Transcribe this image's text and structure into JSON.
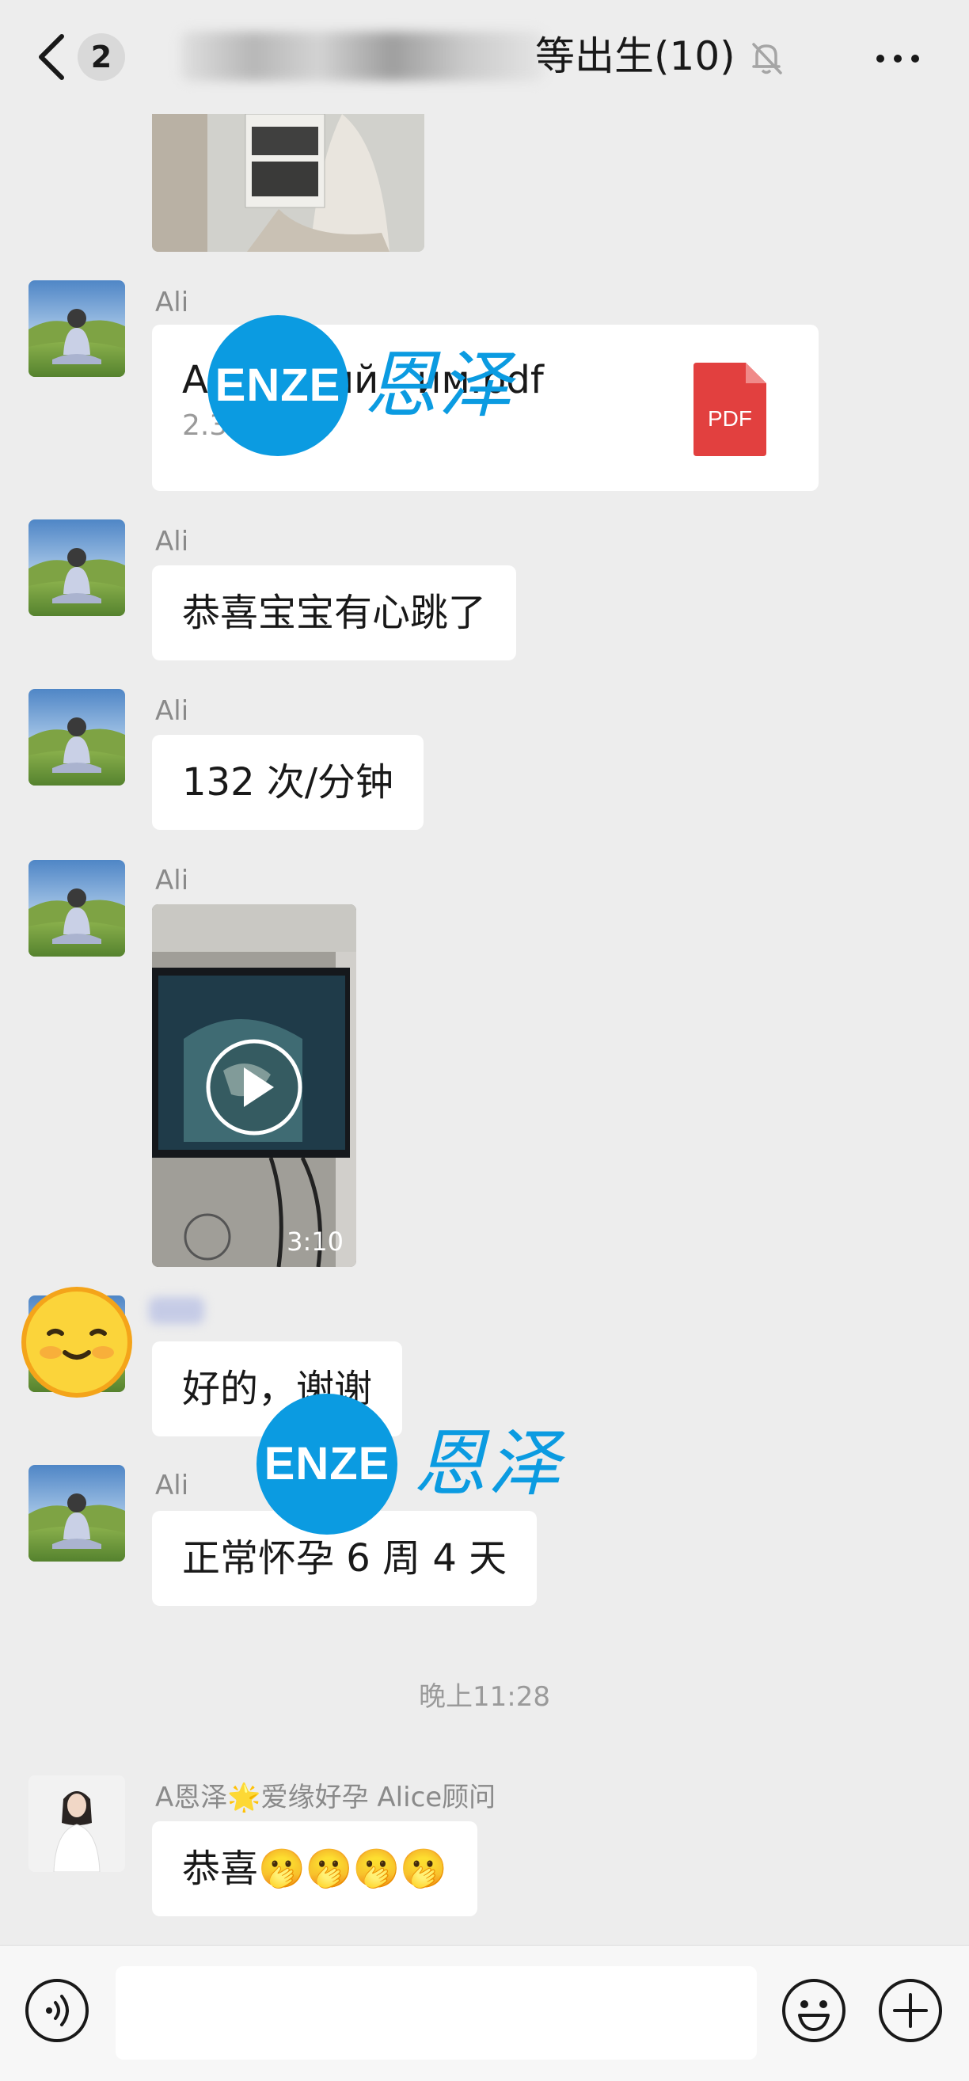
{
  "header": {
    "unread_count": "2",
    "title_visible": "等出生(10)",
    "icons": {
      "back": "chevron-left-icon",
      "mute": "bell-slash-icon",
      "more": "more-dots-icon"
    }
  },
  "messages": {
    "file": {
      "sender": "Ali",
      "file_name_start": "A",
      "file_name_mid": "м",
      "file_name_mid2": "й",
      "file_name_end": "им.pdf",
      "file_size": "2.3",
      "file_type": "PDF"
    },
    "msg1": {
      "sender": "Ali",
      "text": "恭喜宝宝有心跳了"
    },
    "msg2": {
      "sender": "Ali",
      "text": "132 次/分钟"
    },
    "video": {
      "sender": "Ali",
      "duration": "3:10"
    },
    "msg3": {
      "text": "好的，谢谢"
    },
    "msg4": {
      "sender": "Ali",
      "text": "正常怀孕 6 周 4 天"
    },
    "timestamp": "晚上11:28",
    "msg5": {
      "sender_prefix": "A恩泽",
      "sender_badge": "🌟",
      "sender_suffix": "爱缘好孕 Alice顾问",
      "text": "恭喜🫢🫢🫢🫢"
    }
  },
  "watermark": {
    "badge": "ENZE",
    "text": "恩泽"
  },
  "input_bar": {
    "placeholder": "",
    "icons": {
      "voice": "voice-icon",
      "emoji": "emoji-icon",
      "plus": "plus-circle-icon"
    }
  },
  "colors": {
    "background": "#ededed",
    "bubble": "#ffffff",
    "watermark_blue": "#0b9be1",
    "pdf_red": "#e2403f"
  }
}
